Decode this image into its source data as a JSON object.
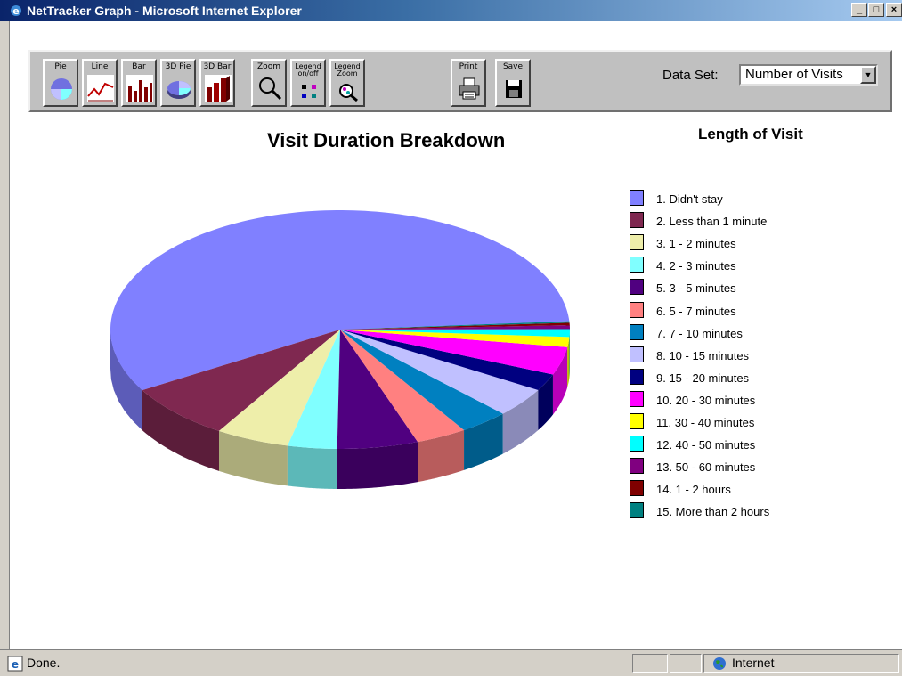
{
  "window": {
    "title": "NetTracker Graph - Microsoft Internet Explorer",
    "controls": [
      "_",
      "□",
      "×"
    ]
  },
  "toolbar": {
    "buttons": [
      {
        "label": "Pie",
        "icon": "pie-chart-icon"
      },
      {
        "label": "Line",
        "icon": "line-chart-icon"
      },
      {
        "label": "Bar",
        "icon": "bar-chart-icon"
      },
      {
        "label": "3D Pie",
        "icon": "3d-pie-chart-icon"
      },
      {
        "label": "3D Bar",
        "icon": "3d-bar-chart-icon"
      },
      {
        "label": "Zoom",
        "icon": "magnifier-icon"
      },
      {
        "label": "Legend on/off",
        "icon": "legend-toggle-icon"
      },
      {
        "label": "Legend Zoom",
        "icon": "legend-zoom-icon"
      },
      {
        "label": "Print",
        "icon": "printer-icon"
      },
      {
        "label": "Save",
        "icon": "floppy-disk-icon"
      }
    ],
    "dataset_label": "Data Set:",
    "dataset_value": "Number of Visits"
  },
  "chart_data": {
    "type": "pie",
    "title": "Visit Duration Breakdown",
    "legend_title": "Length of Visit",
    "legend_placement": "right",
    "three_d": true,
    "categories": [
      "1. Didn't stay",
      "2. Less than 1 minute",
      "3. 1 - 2 minutes",
      "4. 2 - 3 minutes",
      "5. 3 - 5 minutes",
      "6. 5 - 7 minutes",
      "7. 7 - 10 minutes",
      "8. 10 - 15 minutes",
      "9. 15 - 20 minutes",
      "10. 20 - 30 minutes",
      "11. 30 - 40 minutes",
      "12. 40 - 50 minutes",
      "13. 50 - 60 minutes",
      "14. 1 - 2 hours",
      "15. More than 2 hours"
    ],
    "values": [
      54.5,
      7.3,
      4.9,
      3.3,
      5.4,
      3.4,
      3.3,
      3.8,
      2.2,
      3.6,
      1.3,
      1.0,
      0.5,
      0.3,
      0.2
    ],
    "colors": [
      "#8080ff",
      "#7f2850",
      "#eeeeaa",
      "#80ffff",
      "#500080",
      "#ff8080",
      "#0080c0",
      "#c0c0ff",
      "#000080",
      "#ff00ff",
      "#ffff00",
      "#00ffff",
      "#800080",
      "#800000",
      "#008080"
    ]
  },
  "statusbar": {
    "status_text": "Done.",
    "zone_text": "Internet"
  }
}
